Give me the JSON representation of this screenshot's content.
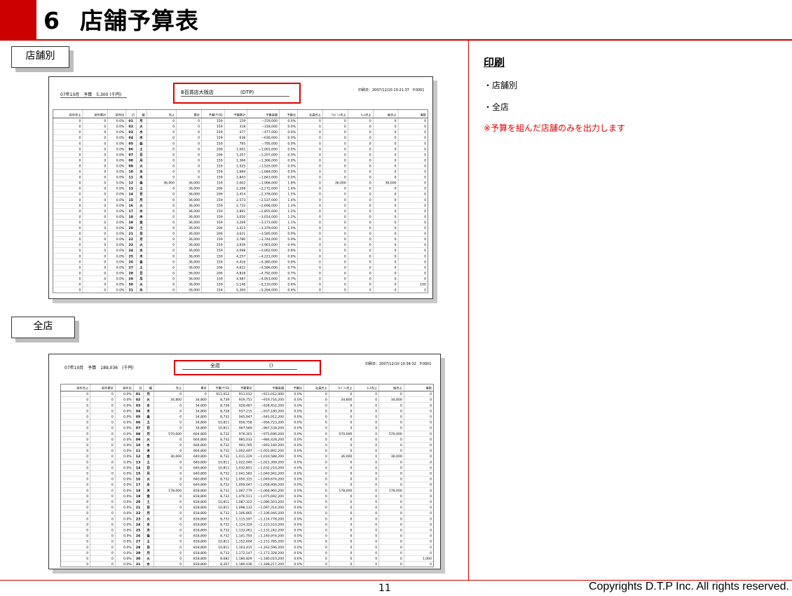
{
  "header": {
    "number": "6",
    "title": "店舗予算表"
  },
  "labels": {
    "store": "店舗別",
    "all": "全店"
  },
  "sheet1": {
    "period": "07年10月　予算　5,300 (千円)",
    "store": "B百貨店大阪店",
    "store_code": "(DTP)",
    "printed": "印刷日：2007/12/10 10:21:37　P.0001",
    "columns": [
      "前年売上",
      "前年累計",
      "前年比",
      "日",
      "曜",
      "売上",
      "累計",
      "予算(千円)",
      "予算累計",
      "予算差額",
      "予算比",
      "社員売上",
      "ｱﾙﾊﾞｲﾄ売上",
      "ｾｰﾙ売上",
      "販売上",
      "客数"
    ],
    "rows": [
      [
        "0",
        "0",
        "0.0%",
        "01",
        "月",
        "0",
        "0",
        "159",
        "159",
        "−159,000",
        "0.0%",
        "0",
        "0",
        "0",
        "0",
        "0"
      ],
      [
        "0",
        "0",
        "0.0%",
        "02",
        "火",
        "0",
        "0",
        "159",
        "318",
        "−318,000",
        "0.0%",
        "0",
        "0",
        "0",
        "0",
        "0"
      ],
      [
        "0",
        "0",
        "0.0%",
        "03",
        "水",
        "0",
        "0",
        "159",
        "477",
        "−477,000",
        "0.0%",
        "0",
        "0",
        "0",
        "0",
        "0"
      ],
      [
        "0",
        "0",
        "0.0%",
        "04",
        "木",
        "0",
        "0",
        "159",
        "636",
        "−636,000",
        "0.0%",
        "0",
        "0",
        "0",
        "0",
        "0"
      ],
      [
        "0",
        "0",
        "0.0%",
        "05",
        "金",
        "0",
        "0",
        "159",
        "795",
        "−795,000",
        "0.0%",
        "0",
        "0",
        "0",
        "0",
        "0"
      ],
      [
        "0",
        "0",
        "0.0%",
        "06",
        "土",
        "0",
        "0",
        "206",
        "1,001",
        "−1,001,000",
        "0.0%",
        "0",
        "0",
        "0",
        "0",
        "0"
      ],
      [
        "0",
        "0",
        "0.0%",
        "07",
        "日",
        "0",
        "0",
        "206",
        "1,207",
        "−1,207,000",
        "0.0%",
        "0",
        "0",
        "0",
        "0",
        "0"
      ],
      [
        "0",
        "0",
        "0.0%",
        "08",
        "月",
        "0",
        "0",
        "159",
        "1,366",
        "−1,366,000",
        "0.0%",
        "0",
        "0",
        "0",
        "0",
        "0"
      ],
      [
        "0",
        "0",
        "0.0%",
        "09",
        "火",
        "0",
        "0",
        "159",
        "1,525",
        "−1,525,000",
        "0.0%",
        "0",
        "0",
        "0",
        "0",
        "0"
      ],
      [
        "0",
        "0",
        "0.0%",
        "10",
        "水",
        "0",
        "0",
        "159",
        "1,684",
        "−1,684,000",
        "0.0%",
        "0",
        "0",
        "0",
        "0",
        "0"
      ],
      [
        "0",
        "0",
        "0.0%",
        "11",
        "木",
        "0",
        "0",
        "159",
        "1,843",
        "−1,843,000",
        "0.0%",
        "0",
        "0",
        "0",
        "0",
        "0"
      ],
      [
        "0",
        "0",
        "0.0%",
        "12",
        "金",
        "36,000",
        "36,000",
        "159",
        "2,002",
        "−1,966,000",
        "1.8%",
        "0",
        "36,000",
        "0",
        "36,000",
        "0"
      ],
      [
        "0",
        "0",
        "0.0%",
        "13",
        "土",
        "0",
        "36,000",
        "206",
        "2,208",
        "−2,172,000",
        "1.6%",
        "0",
        "0",
        "0",
        "0",
        "0"
      ],
      [
        "0",
        "0",
        "0.0%",
        "14",
        "日",
        "0",
        "36,000",
        "206",
        "2,414",
        "−2,378,000",
        "1.5%",
        "0",
        "0",
        "0",
        "0",
        "0"
      ],
      [
        "0",
        "0",
        "0.0%",
        "15",
        "月",
        "0",
        "36,000",
        "159",
        "2,573",
        "−2,537,000",
        "1.4%",
        "0",
        "0",
        "0",
        "0",
        "0"
      ],
      [
        "0",
        "0",
        "0.0%",
        "16",
        "火",
        "0",
        "36,000",
        "159",
        "2,732",
        "−2,696,000",
        "1.3%",
        "0",
        "0",
        "0",
        "0",
        "0"
      ],
      [
        "0",
        "0",
        "0.0%",
        "17",
        "水",
        "0",
        "36,000",
        "159",
        "2,891",
        "−2,855,000",
        "1.2%",
        "0",
        "0",
        "0",
        "0",
        "0"
      ],
      [
        "0",
        "0",
        "0.0%",
        "18",
        "木",
        "0",
        "36,000",
        "159",
        "3,050",
        "−3,014,000",
        "1.2%",
        "0",
        "0",
        "0",
        "0",
        "0"
      ],
      [
        "0",
        "0",
        "0.0%",
        "19",
        "金",
        "0",
        "36,000",
        "159",
        "3,209",
        "−3,173,000",
        "1.1%",
        "0",
        "0",
        "0",
        "0",
        "0"
      ],
      [
        "0",
        "0",
        "0.0%",
        "20",
        "土",
        "0",
        "36,000",
        "206",
        "3,415",
        "−3,379,000",
        "1.0%",
        "0",
        "0",
        "0",
        "0",
        "0"
      ],
      [
        "0",
        "0",
        "0.0%",
        "21",
        "日",
        "0",
        "36,000",
        "206",
        "3,621",
        "−3,585,000",
        "0.9%",
        "0",
        "0",
        "0",
        "0",
        "0"
      ],
      [
        "0",
        "0",
        "0.0%",
        "22",
        "月",
        "0",
        "36,000",
        "159",
        "3,780",
        "−3,744,000",
        "0.9%",
        "0",
        "0",
        "0",
        "0",
        "0"
      ],
      [
        "0",
        "0",
        "0.0%",
        "23",
        "火",
        "0",
        "36,000",
        "159",
        "3,939",
        "−3,903,000",
        "0.9%",
        "0",
        "0",
        "0",
        "0",
        "0"
      ],
      [
        "0",
        "0",
        "0.0%",
        "24",
        "水",
        "0",
        "36,000",
        "159",
        "4,098",
        "−4,062,000",
        "0.8%",
        "0",
        "0",
        "0",
        "0",
        "0"
      ],
      [
        "0",
        "0",
        "0.0%",
        "25",
        "木",
        "0",
        "36,000",
        "159",
        "4,257",
        "−4,221,000",
        "0.8%",
        "0",
        "0",
        "0",
        "0",
        "0"
      ],
      [
        "0",
        "0",
        "0.0%",
        "26",
        "金",
        "0",
        "36,000",
        "159",
        "4,416",
        "−4,380,000",
        "0.8%",
        "0",
        "0",
        "0",
        "0",
        "0"
      ],
      [
        "0",
        "0",
        "0.0%",
        "27",
        "土",
        "0",
        "36,000",
        "206",
        "4,622",
        "−4,586,000",
        "0.7%",
        "0",
        "0",
        "0",
        "0",
        "0"
      ],
      [
        "0",
        "0",
        "0.0%",
        "28",
        "日",
        "0",
        "36,000",
        "206",
        "4,828",
        "−4,792,000",
        "0.7%",
        "0",
        "0",
        "0",
        "0",
        "0"
      ],
      [
        "0",
        "0",
        "0.0%",
        "29",
        "月",
        "0",
        "36,000",
        "159",
        "4,987",
        "−4,951,000",
        "0.7%",
        "0",
        "0",
        "0",
        "0",
        "0"
      ],
      [
        "0",
        "0",
        "0.0%",
        "30",
        "火",
        "0",
        "36,000",
        "159",
        "5,146",
        "−5,110,000",
        "0.6%",
        "0",
        "0",
        "0",
        "0",
        "100"
      ],
      [
        "0",
        "0",
        "0.0%",
        "31",
        "水",
        "0",
        "36,000",
        "154",
        "5,300",
        "−5,264,000",
        "0.6%",
        "0",
        "0",
        "0",
        "0",
        "0"
      ]
    ]
  },
  "sheet2": {
    "period": "07年10月　予算　189,036　(千円)",
    "store": "全店",
    "store_code": "()",
    "printed": "印刷日：2007/12/10 10:34:32　P.0001",
    "columns": [
      "前年売上",
      "前年累計",
      "前年比",
      "日",
      "曜",
      "売上",
      "累計",
      "予算(千円)",
      "予算累計",
      "予算差額",
      "予算比",
      "社員売上",
      "ｱﾙﾊﾞｲﾄ売上",
      "ｾｰﾙ売上",
      "販売上",
      "客数"
    ],
    "rows": [
      [
        "0",
        "0",
        "0.0%",
        "01",
        "月",
        "0",
        "0",
        "911,012",
        "911,012",
        "−911,012,000",
        "0.0%",
        "0",
        "0",
        "0",
        "0",
        "0"
      ],
      [
        "0",
        "0",
        "0.0%",
        "02",
        "火",
        "34,800",
        "34,800",
        "8,739",
        "919,751",
        "−919,716,200",
        "0.0%",
        "0",
        "34,800",
        "0",
        "34,800",
        "0"
      ],
      [
        "0",
        "0",
        "0.0%",
        "03",
        "水",
        "0",
        "34,800",
        "8,736",
        "928,487",
        "−928,452,200",
        "0.0%",
        "0",
        "0",
        "0",
        "0",
        "0"
      ],
      [
        "0",
        "0",
        "0.0%",
        "04",
        "木",
        "0",
        "34,800",
        "8,728",
        "937,215",
        "−937,180,200",
        "0.0%",
        "0",
        "0",
        "0",
        "0",
        "0"
      ],
      [
        "0",
        "0",
        "0.0%",
        "05",
        "金",
        "0",
        "34,800",
        "8,732",
        "945,947",
        "−945,912,200",
        "0.0%",
        "0",
        "0",
        "0",
        "0",
        "0"
      ],
      [
        "0",
        "0",
        "0.0%",
        "06",
        "土",
        "0",
        "34,800",
        "10,811",
        "956,758",
        "−956,723,200",
        "0.0%",
        "0",
        "0",
        "0",
        "0",
        "0"
      ],
      [
        "0",
        "0",
        "0.0%",
        "07",
        "日",
        "0",
        "34,800",
        "10,811",
        "967,569",
        "−967,534,200",
        "0.0%",
        "0",
        "0",
        "0",
        "0",
        "0"
      ],
      [
        "0",
        "0",
        "0.0%",
        "08",
        "月",
        "570,000",
        "604,800",
        "8,732",
        "976,301",
        "−975,696,200",
        "0.0%",
        "0",
        "570,000",
        "0",
        "570,000",
        "0"
      ],
      [
        "0",
        "0",
        "0.0%",
        "09",
        "火",
        "0",
        "604,800",
        "8,732",
        "985,033",
        "−984,428,200",
        "0.0%",
        "0",
        "0",
        "0",
        "0",
        "0"
      ],
      [
        "0",
        "0",
        "0.0%",
        "10",
        "水",
        "0",
        "604,800",
        "8,732",
        "993,765",
        "−993,160,200",
        "0.0%",
        "0",
        "0",
        "0",
        "0",
        "0"
      ],
      [
        "0",
        "0",
        "0.0%",
        "11",
        "木",
        "0",
        "604,800",
        "8,732",
        "1,002,497",
        "−1,001,892,200",
        "0.0%",
        "0",
        "0",
        "0",
        "0",
        "0"
      ],
      [
        "0",
        "0",
        "0.0%",
        "12",
        "金",
        "36,000",
        "640,800",
        "8,732",
        "1,011,229",
        "−1,010,588,200",
        "0.0%",
        "0",
        "36,000",
        "0",
        "36,000",
        "0"
      ],
      [
        "0",
        "0",
        "0.0%",
        "13",
        "土",
        "0",
        "640,800",
        "10,811",
        "1,022,040",
        "−1,021,399,200",
        "0.0%",
        "0",
        "0",
        "0",
        "0",
        "0"
      ],
      [
        "0",
        "0",
        "0.0%",
        "14",
        "日",
        "0",
        "640,800",
        "10,811",
        "1,032,851",
        "−1,032,210,200",
        "0.0%",
        "0",
        "0",
        "0",
        "0",
        "0"
      ],
      [
        "0",
        "0",
        "0.0%",
        "15",
        "月",
        "0",
        "640,800",
        "8,732",
        "1,041,583",
        "−1,040,942,200",
        "0.0%",
        "0",
        "0",
        "0",
        "0",
        "0"
      ],
      [
        "0",
        "0",
        "0.0%",
        "16",
        "火",
        "0",
        "640,800",
        "8,732",
        "1,050,315",
        "−1,049,674,200",
        "0.0%",
        "0",
        "0",
        "0",
        "0",
        "0"
      ],
      [
        "0",
        "0",
        "0.0%",
        "17",
        "水",
        "0",
        "640,800",
        "8,732",
        "1,059,047",
        "−1,058,406,200",
        "0.0%",
        "0",
        "0",
        "0",
        "0",
        "0"
      ],
      [
        "0",
        "0",
        "0.0%",
        "18",
        "木",
        "178,000",
        "818,800",
        "8,732",
        "1,067,779",
        "−1,066,960,200",
        "0.0%",
        "0",
        "178,000",
        "0",
        "178,000",
        "0"
      ],
      [
        "0",
        "0",
        "0.0%",
        "19",
        "金",
        "0",
        "818,800",
        "8,732",
        "1,076,511",
        "−1,075,692,200",
        "0.0%",
        "0",
        "0",
        "0",
        "0",
        "0"
      ],
      [
        "0",
        "0",
        "0.0%",
        "20",
        "土",
        "0",
        "818,800",
        "10,811",
        "1,087,322",
        "−1,086,503,200",
        "0.0%",
        "0",
        "0",
        "0",
        "0",
        "0"
      ],
      [
        "0",
        "0",
        "0.0%",
        "21",
        "日",
        "0",
        "818,800",
        "10,811",
        "1,098,133",
        "−1,097,314,200",
        "0.0%",
        "0",
        "0",
        "0",
        "0",
        "0"
      ],
      [
        "0",
        "0",
        "0.0%",
        "22",
        "月",
        "0",
        "818,800",
        "8,732",
        "1,106,865",
        "−1,106,046,200",
        "0.0%",
        "0",
        "0",
        "0",
        "0",
        "0"
      ],
      [
        "0",
        "0",
        "0.0%",
        "23",
        "火",
        "0",
        "818,800",
        "8,732",
        "1,115,597",
        "−1,114,778,200",
        "0.0%",
        "0",
        "0",
        "0",
        "0",
        "0"
      ],
      [
        "0",
        "0",
        "0.0%",
        "24",
        "水",
        "0",
        "818,800",
        "8,732",
        "1,124,329",
        "−1,123,510,200",
        "0.0%",
        "0",
        "0",
        "0",
        "0",
        "0"
      ],
      [
        "0",
        "0",
        "0.0%",
        "25",
        "木",
        "0",
        "818,800",
        "8,732",
        "1,133,061",
        "−1,132,242,200",
        "0.0%",
        "0",
        "0",
        "0",
        "0",
        "0"
      ],
      [
        "0",
        "0",
        "0.0%",
        "26",
        "金",
        "0",
        "818,800",
        "8,732",
        "1,141,793",
        "−1,140,974,200",
        "0.0%",
        "0",
        "0",
        "0",
        "0",
        "0"
      ],
      [
        "0",
        "0",
        "0.0%",
        "27",
        "土",
        "0",
        "818,800",
        "10,811",
        "1,152,604",
        "−1,151,785,200",
        "0.0%",
        "0",
        "0",
        "0",
        "0",
        "0"
      ],
      [
        "0",
        "0",
        "0.0%",
        "28",
        "日",
        "0",
        "818,800",
        "10,811",
        "1,163,415",
        "−1,162,596,200",
        "0.0%",
        "0",
        "0",
        "0",
        "0",
        "0"
      ],
      [
        "0",
        "0",
        "0.0%",
        "29",
        "月",
        "0",
        "818,800",
        "8,732",
        "1,172,147",
        "−1,171,328,200",
        "0.0%",
        "0",
        "0",
        "0",
        "0",
        "0"
      ],
      [
        "0",
        "0",
        "0.0%",
        "30",
        "火",
        "0",
        "818,800",
        "8,682",
        "1,180,829",
        "−1,180,010,200",
        "0.0%",
        "0",
        "0",
        "0",
        "0",
        "1,000"
      ],
      [
        "0",
        "0",
        "0.0%",
        "31",
        "水",
        "0",
        "818,800",
        "8,207",
        "1,189,036",
        "−1,188,217,200",
        "0.0%",
        "0",
        "0",
        "0",
        "0",
        "0"
      ]
    ]
  },
  "sidebar": {
    "title": "印刷",
    "items": [
      "・店舗別",
      "・全店"
    ],
    "note": "※予算を組んだ店舗のみを出力します"
  },
  "footer": {
    "page": "11",
    "copyright": "Copyrights  D.T.P Inc. All rights reserved."
  }
}
